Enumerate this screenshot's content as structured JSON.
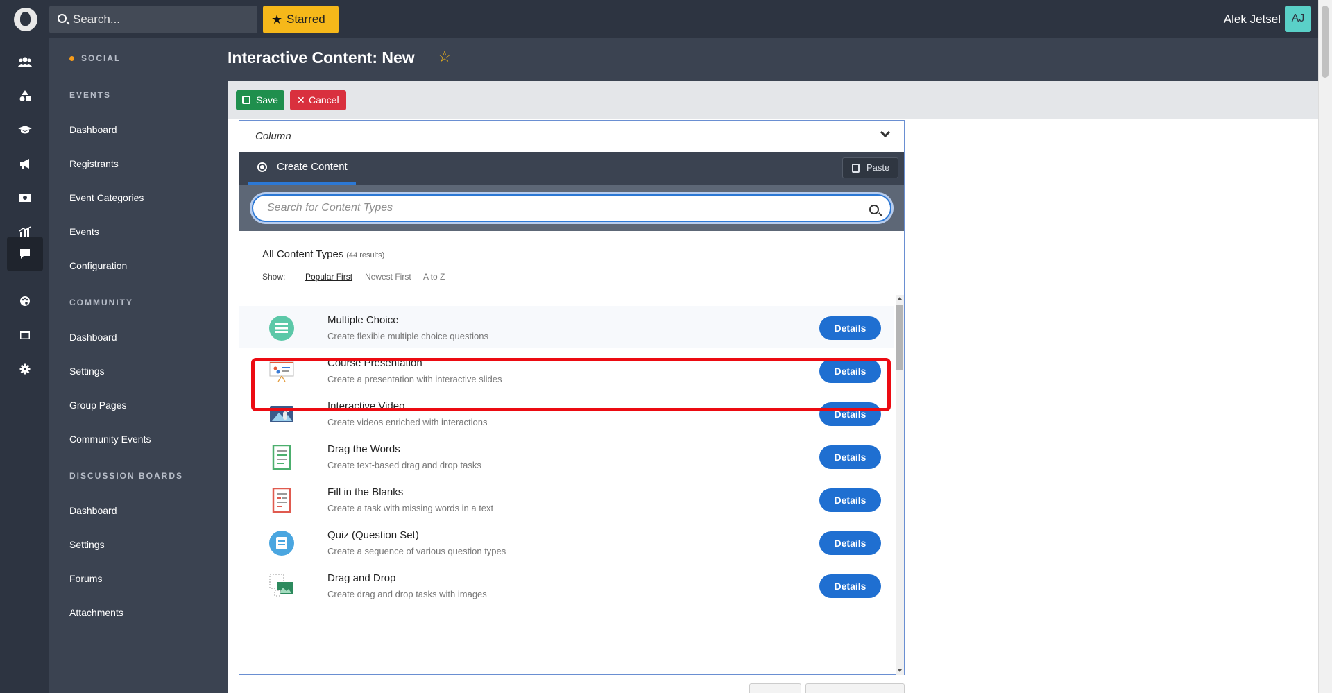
{
  "topbar": {
    "search_label": "Search...",
    "starred_label": "Starred",
    "user_name": "Alek Jetsel",
    "avatar_initials": "AJ"
  },
  "rail": {
    "items": [
      {
        "icon": "users-icon"
      },
      {
        "icon": "shapes-icon"
      },
      {
        "icon": "graduation-cap-icon"
      },
      {
        "icon": "megaphone-icon"
      },
      {
        "icon": "money-icon"
      },
      {
        "icon": "analytics-icon"
      },
      {
        "icon": "chat-icon",
        "active": true
      },
      {
        "icon": "palette-icon"
      },
      {
        "icon": "window-icon"
      },
      {
        "icon": "gear-icon"
      }
    ]
  },
  "nav": {
    "social": "SOCIAL",
    "events_heading": "EVENTS",
    "events": [
      "Dashboard",
      "Registrants",
      "Event Categories",
      "Events",
      "Configuration"
    ],
    "community_heading": "COMMUNITY",
    "community": [
      "Dashboard",
      "Settings",
      "Group Pages",
      "Community Events"
    ],
    "boards_heading": "DISCUSSION BOARDS",
    "boards": [
      "Dashboard",
      "Settings",
      "Forums",
      "Attachments"
    ]
  },
  "page": {
    "title": "Interactive Content: New"
  },
  "toolbar": {
    "save_label": "Save",
    "cancel_label": "Cancel"
  },
  "editor": {
    "column_label": "Column",
    "tab_create": "Create Content",
    "paste_label": "Paste",
    "search_placeholder": "Search for Content Types",
    "results_title": "All Content Types",
    "results_count": "(44 results)",
    "show_label": "Show:",
    "sort_options": [
      "Popular First",
      "Newest First",
      "A to Z"
    ],
    "details_label": "Details",
    "content_types": [
      {
        "name": "Multiple Choice",
        "desc": "Create flexible multiple choice questions",
        "icon": "multiple-choice-icon"
      },
      {
        "name": "Course Presentation",
        "desc": "Create a presentation with interactive slides",
        "icon": "presentation-icon"
      },
      {
        "name": "Interactive Video",
        "desc": "Create videos enriched with interactions",
        "icon": "video-icon"
      },
      {
        "name": "Drag the Words",
        "desc": "Create text-based drag and drop tasks",
        "icon": "drag-words-icon"
      },
      {
        "name": "Fill in the Blanks",
        "desc": "Create a task with missing words in a text",
        "icon": "fill-blanks-icon"
      },
      {
        "name": "Quiz (Question Set)",
        "desc": "Create a sequence of various question types",
        "icon": "quiz-icon"
      },
      {
        "name": "Drag and Drop",
        "desc": "Create drag and drop tasks with images",
        "icon": "drag-drop-icon"
      }
    ]
  },
  "colors": {
    "dark_bg": "#2d3441",
    "nav_bg": "#3b4351",
    "accent_blue": "#1f6fd1",
    "starred": "#f6b81a",
    "save": "#1f8f4d",
    "cancel": "#d9303e",
    "highlight": "#ec0b12"
  }
}
